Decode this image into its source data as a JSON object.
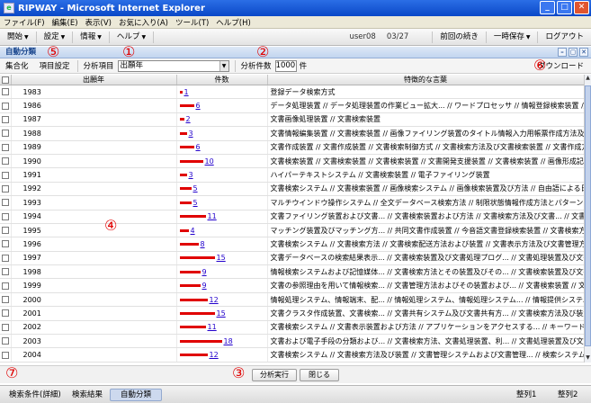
{
  "window": {
    "title": "RIPWAY - Microsoft Internet Explorer",
    "icon": "ie-icon",
    "min": "_",
    "max": "□",
    "close": "✕"
  },
  "menu": [
    "ファイル(F)",
    "編集(E)",
    "表示(V)",
    "お気に入り(A)",
    "ツール(T)",
    "ヘルプ(H)"
  ],
  "toolbar": {
    "start": "開始",
    "settings": "設定",
    "info": "情報",
    "help": "ヘルプ",
    "user": "user08",
    "date": "03/27",
    "resume": "前回の続き",
    "temp_save": "一時保存",
    "logout": "ログアウト"
  },
  "panel": {
    "title": "自動分類",
    "btn_min": "–",
    "btn_restore": "▢",
    "btn_close": "✕"
  },
  "controls": {
    "aggregate": "集合化",
    "item_settings": "項目設定",
    "analysis_item_label": "分析項目",
    "analysis_item_value": "出願年",
    "count_label": "分析件数",
    "count_value": "1000",
    "count_unit": "件",
    "download": "ダウンロード"
  },
  "table": {
    "headers": {
      "year": "出願年",
      "count": "件数",
      "words": "特徴的な言葉"
    },
    "rows": [
      {
        "year": "1983",
        "count": "1",
        "words": "登録データ検索方式"
      },
      {
        "year": "1986",
        "count": "6",
        "words": "データ処理装置 // データ処理装置の作業ビュー拡大... // ワードプロセッサ // 情報登録検索装置 // 文書作成装"
      },
      {
        "year": "1987",
        "count": "2",
        "words": "文書画像処理装置 // 文書検索装置"
      },
      {
        "year": "1988",
        "count": "3",
        "words": "文書情報編集装置 // 文書検索装置 // 画像ファイリング装置のタイトル情報入力用帳票作成方法及び画像ファイリ"
      },
      {
        "year": "1989",
        "count": "6",
        "words": "文書作成装置 // 文書作成装置 // 文書検索制御方式 // 文書検索方法及び文書検索装置 // 文書作成方法及び文"
      },
      {
        "year": "1990",
        "count": "10",
        "words": "文書検索装置 // 文書検索装置 // 文書検索装置 // 文書開発支援装置 // 文書検索装置 // 画像形成記憶装"
      },
      {
        "year": "1991",
        "count": "3",
        "words": "ハイパーテキストシステム // 文書検索装置 // 電子ファイリング装置"
      },
      {
        "year": "1992",
        "count": "5",
        "words": "文書検索システム // 文書検索装置 // 画像検索システム // 画像検索装置及び方法 // 自由語による日本語文"
      },
      {
        "year": "1993",
        "count": "5",
        "words": "マルチウインドウ操作システム // 全文データベース検索方法 // 制限状態情報作成方法とパターン... // 検索装置及び"
      },
      {
        "year": "1994",
        "count": "11",
        "words": "文書ファイリング装置および文書... // 文書検索装置および方法 // 文書検索方法及び文書... // 文書検索装置及び"
      },
      {
        "year": "1995",
        "count": "4",
        "words": "マッチング装置及びマッチング方... // 共同文書作成装置 // 今音語文書登録検索装置 // 文書検索方法及び装置"
      },
      {
        "year": "1996",
        "count": "8",
        "words": "文書検索システム // 文書検索方法 // 文書検索配送方法および装置 // 文書表示方法及び文書管理方法 // ド"
      },
      {
        "year": "1997",
        "count": "15",
        "words": "文書データベースの検索結果表示... // 文書検索装置及び文書処理プログ... // 文書処理装置及び文書検索方法 /"
      },
      {
        "year": "1998",
        "count": "9",
        "words": "情報検索システムおよび記憶媒体... // 文書検索方法とその装置及びその... // 文書検索装置及び文書検索方法 /"
      },
      {
        "year": "1999",
        "count": "9",
        "words": "文書の参照理由を用いて情報検索... // 文書管理方法およびその装置および... // 文書検索装置 // 文書検索装置"
      },
      {
        "year": "2000",
        "count": "12",
        "words": "情報処理システム、情報端末、配... // 情報処理システム、情報処理システム... // 情報提供システムおよび方法、お... //"
      },
      {
        "year": "2001",
        "count": "15",
        "words": "文書クラスタ作成装置、文書検索... // 文書共有システム及び文書共有方... // 文書検索方法及び装置 // 文書検索"
      },
      {
        "year": "2002",
        "count": "11",
        "words": "文書検索システム // 文書表示装置および方法 // アプリケーションをアクセスする... // キーワード抽出装置及びプログ"
      },
      {
        "year": "2003",
        "count": "18",
        "words": "文書および電子手段の分類および... // 文書検索方法、文書処理装置、利... // 文書処理装置及び文書処理方法、制"
      },
      {
        "year": "2004",
        "count": "12",
        "words": "文書検索システム // 文書検索方法及び装置 // 文書管理システムおよび文書管理... // 検索システム及び記録媒体"
      },
      {
        "year": "2005",
        "count": "12",
        "words": "情報処理装置及びその制御方法... // 情報処理装置及び方法、並びにプ... // 情報検索装置、情報検索方法、プ..."
      }
    ]
  },
  "actions": {
    "run": "分析実行",
    "close": "閉じる"
  },
  "tabs": {
    "search_conditions": "検索条件(詳細)",
    "search_results": "検索結果",
    "auto_classify": "自動分類",
    "sort1": "整列1",
    "sort2": "整列2"
  },
  "annotations": {
    "m1": "①",
    "m2": "②",
    "m3": "③",
    "m4": "④",
    "m5": "⑤",
    "m6": "⑥",
    "m7": "⑦"
  },
  "colors": {
    "bar": "#e00000",
    "link": "#2200cc"
  }
}
